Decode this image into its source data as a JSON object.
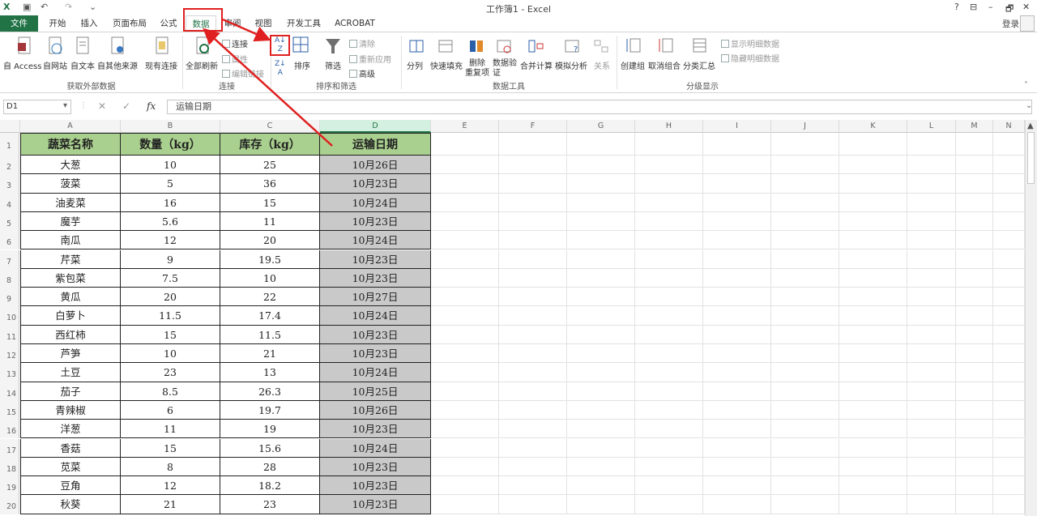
{
  "titlebar": {
    "title": "工作簿1 - Excel",
    "help": "?",
    "minimize": "–",
    "restore": "🗗",
    "close": "✕",
    "ribbon_display": "⊟"
  },
  "tabs": [
    "文件",
    "开始",
    "插入",
    "页面布局",
    "公式",
    "数据",
    "审阅",
    "视图",
    "开发工具",
    "ACROBAT"
  ],
  "login": "登录",
  "ribbon": {
    "get_external": {
      "label": "获取外部数据",
      "items": [
        "自 Access",
        "自网站",
        "自文本",
        "自其他来源",
        "现有连接"
      ]
    },
    "connections": {
      "label": "连接",
      "refresh": "全部刷新",
      "small": [
        "连接",
        "属性",
        "编辑链接"
      ]
    },
    "sort_filter": {
      "label": "排序和筛选",
      "sort": "排序",
      "filter": "筛选",
      "small": [
        "清除",
        "重新应用",
        "高级"
      ]
    },
    "data_tools": {
      "label": "数据工具",
      "items": [
        "分列",
        "快速填充",
        "删除\n重复项",
        "数据验\n证",
        "合并计算",
        "模拟分析",
        "关系"
      ]
    },
    "outline": {
      "label": "分级显示",
      "items": [
        "创建组",
        "取消组合",
        "分类汇总"
      ],
      "small": [
        "显示明细数据",
        "隐藏明细数据"
      ]
    }
  },
  "formula_bar": {
    "name_box": "D1",
    "fx": "fx",
    "value": "运输日期"
  },
  "columns": [
    "A",
    "B",
    "C",
    "D",
    "E",
    "F",
    "G",
    "H",
    "I",
    "J",
    "K",
    "L",
    "M",
    "N"
  ],
  "table": {
    "headers": [
      "蔬菜名称",
      "数量（kg）",
      "库存（kg）",
      "运输日期"
    ],
    "rows": [
      [
        "大葱",
        "10",
        "25",
        "10月26日"
      ],
      [
        "菠菜",
        "5",
        "36",
        "10月23日"
      ],
      [
        "油麦菜",
        "16",
        "15",
        "10月24日"
      ],
      [
        "魔芋",
        "5.6",
        "11",
        "10月23日"
      ],
      [
        "南瓜",
        "12",
        "20",
        "10月24日"
      ],
      [
        "芹菜",
        "9",
        "19.5",
        "10月23日"
      ],
      [
        "紫包菜",
        "7.5",
        "10",
        "10月23日"
      ],
      [
        "黄瓜",
        "20",
        "22",
        "10月27日"
      ],
      [
        "白萝卜",
        "11.5",
        "17.4",
        "10月24日"
      ],
      [
        "西红柿",
        "15",
        "11.5",
        "10月23日"
      ],
      [
        "芦笋",
        "10",
        "21",
        "10月23日"
      ],
      [
        "土豆",
        "23",
        "13",
        "10月24日"
      ],
      [
        "茄子",
        "8.5",
        "26.3",
        "10月25日"
      ],
      [
        "青辣椒",
        "6",
        "19.7",
        "10月26日"
      ],
      [
        "洋葱",
        "11",
        "19",
        "10月23日"
      ],
      [
        "香菇",
        "15",
        "15.6",
        "10月24日"
      ],
      [
        "苋菜",
        "8",
        "28",
        "10月23日"
      ],
      [
        "豆角",
        "12",
        "18.2",
        "10月23日"
      ],
      [
        "秋葵",
        "21",
        "23",
        "10月23日"
      ]
    ]
  },
  "row_numbers": [
    "1",
    "2",
    "3",
    "4",
    "5",
    "6",
    "7",
    "8",
    "9",
    "10",
    "11",
    "12",
    "13",
    "14",
    "15",
    "16",
    "17",
    "18",
    "19",
    "20"
  ],
  "colors": {
    "excel_green": "#217346",
    "header_fill": "#a9d08e",
    "date_fill": "#c9c9c9",
    "annotation": "#e02020"
  }
}
